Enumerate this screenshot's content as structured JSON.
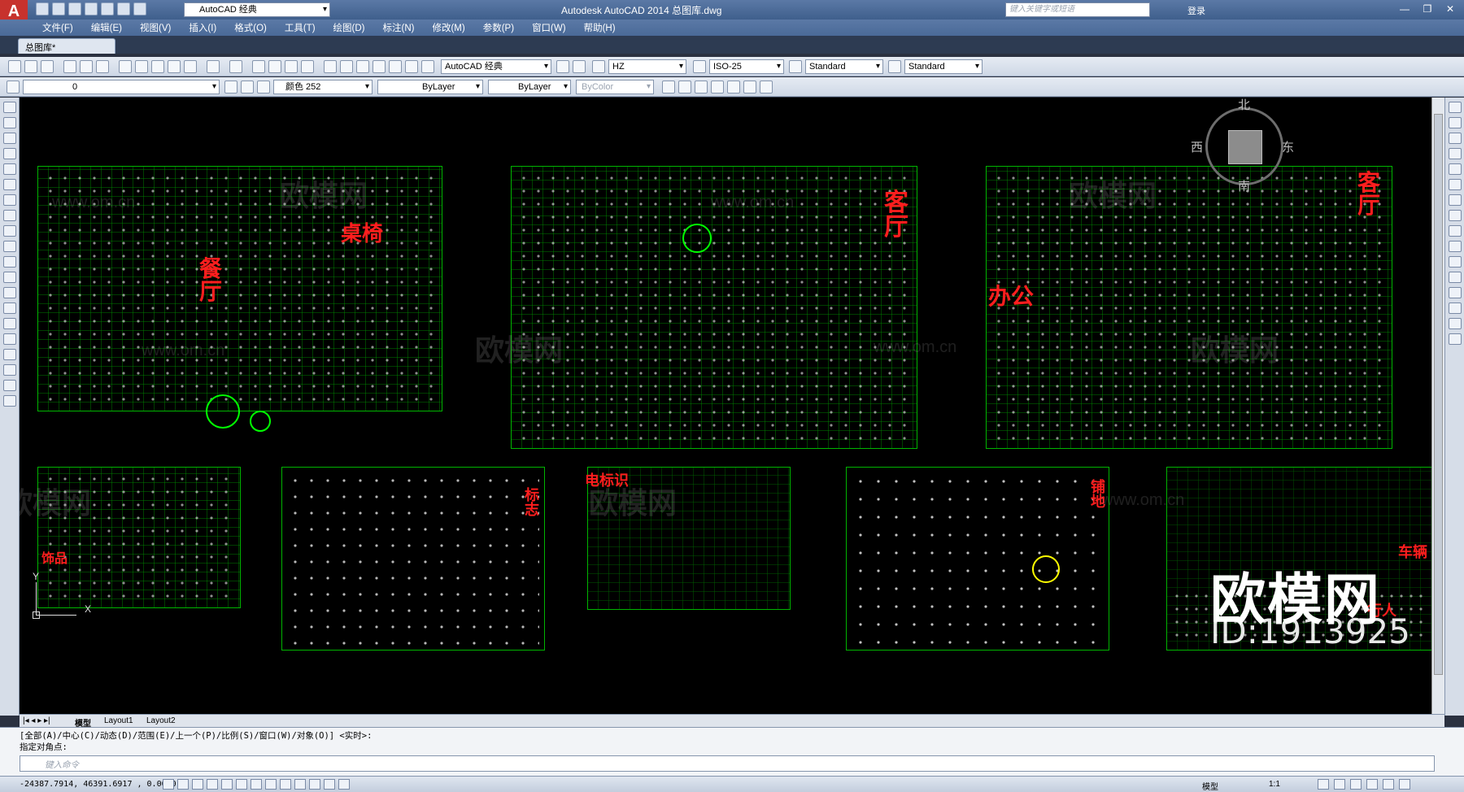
{
  "app": {
    "title": "Autodesk AutoCAD 2014    总图库.dwg",
    "logo": "A",
    "workspace": "AutoCAD 经典",
    "search_placeholder": "键入关键字或短语",
    "login": "登录"
  },
  "menu": [
    "文件(F)",
    "编辑(E)",
    "视图(V)",
    "插入(I)",
    "格式(O)",
    "工具(T)",
    "绘图(D)",
    "标注(N)",
    "修改(M)",
    "参数(P)",
    "窗口(W)",
    "帮助(H)"
  ],
  "doc_tab": "总图库*",
  "toolbar1": {
    "workspace_combo": "AutoCAD 经典",
    "text_style": "HZ",
    "dim_style": "ISO-25",
    "table_style": "Standard",
    "multileader_style": "Standard"
  },
  "toolbar2": {
    "layer": "0",
    "color": "颜色 252",
    "linetype": "ByLayer",
    "lineweight": "ByLayer",
    "plotstyle": "ByColor"
  },
  "viewcube": {
    "north": "北",
    "south": "南",
    "east": "东",
    "west": "西"
  },
  "ucs": {
    "x": "X",
    "y": "Y"
  },
  "panels": [
    {
      "id": "dining",
      "labels": [
        "桌椅",
        "餐厅"
      ]
    },
    {
      "id": "living",
      "labels": [
        "客厅"
      ]
    },
    {
      "id": "office",
      "labels": [
        "办公",
        "客厅"
      ]
    },
    {
      "id": "decor",
      "labels": [
        "饰品"
      ]
    },
    {
      "id": "signs",
      "labels": [
        "标志"
      ]
    },
    {
      "id": "electric",
      "labels": [
        "电标识"
      ]
    },
    {
      "id": "paving",
      "labels": [
        "铺地"
      ]
    },
    {
      "id": "vehicles",
      "labels": [
        "车辆",
        "行人"
      ]
    }
  ],
  "watermark": {
    "brand": "欧模网",
    "url": "www.om.cn",
    "id": "ID:1913925"
  },
  "layout_tabs": [
    "模型",
    "Layout1",
    "Layout2"
  ],
  "command": {
    "history_line": "[全部(A)/中心(C)/动态(D)/范围(E)/上一个(P)/比例(S)/窗口(W)/对象(O)] <实时>:",
    "prompt_line": "指定对角点:",
    "input_placeholder": "键入命令"
  },
  "status": {
    "coords": "-24387.7914, 46391.6917 , 0.0000",
    "model": "模型",
    "scale": "1:1"
  },
  "colors": {
    "accent_red": "#ff1e1e",
    "line_green": "#00ff00",
    "canvas": "#000000"
  }
}
